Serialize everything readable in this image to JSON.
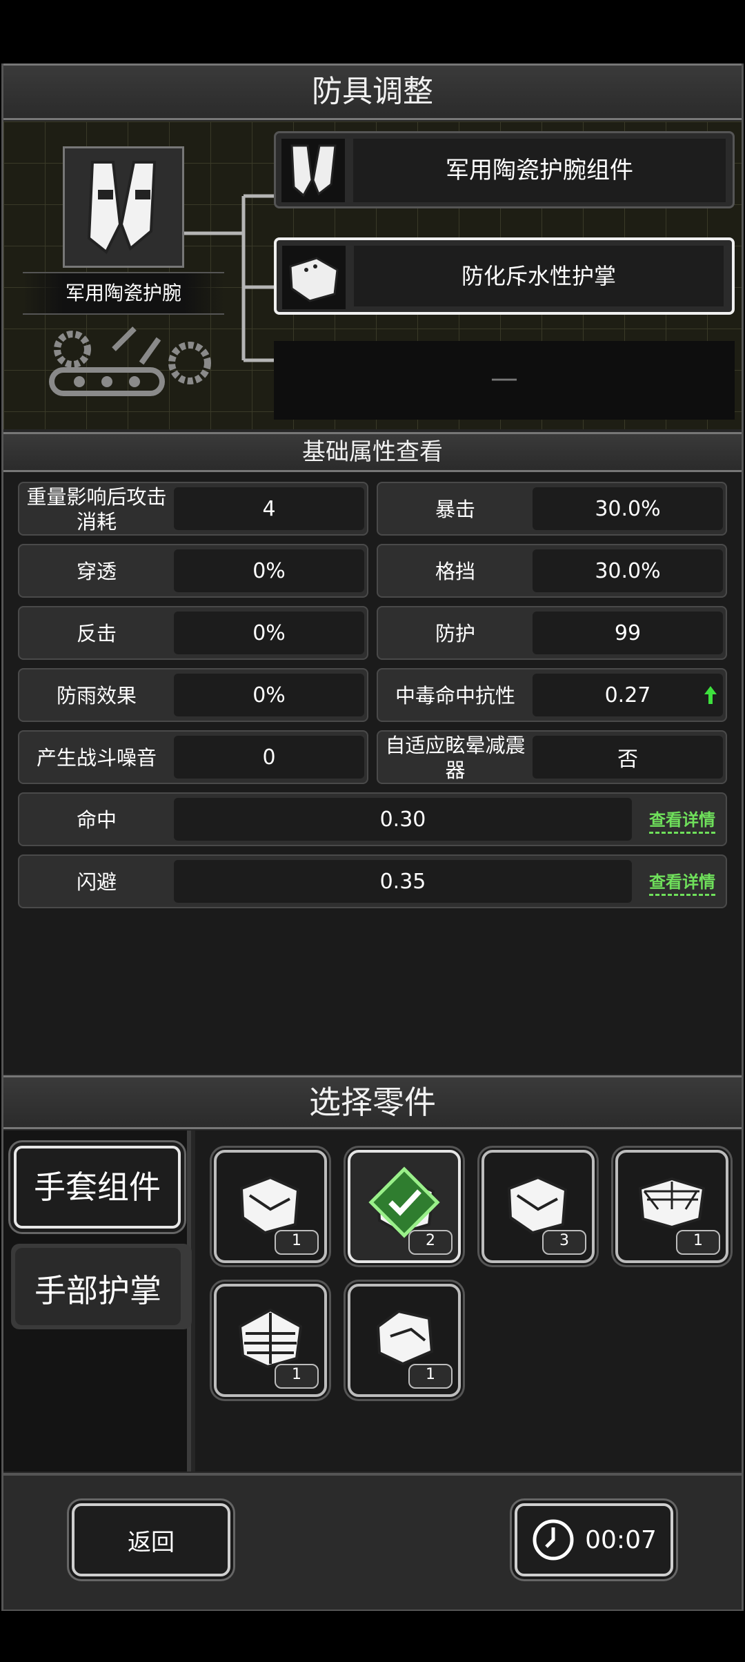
{
  "header": {
    "title": "防具调整"
  },
  "armor": {
    "main_name": "军用陶瓷护腕",
    "components": [
      {
        "label": "军用陶瓷护腕组件"
      },
      {
        "label": "防化斥水性护掌"
      },
      {
        "label": "—"
      }
    ]
  },
  "stats": {
    "title": "基础属性查看",
    "pairs": [
      {
        "left_label": "重量影响后攻击消耗",
        "left_value": "4",
        "right_label": "暴击",
        "right_value": "30.0%"
      },
      {
        "left_label": "穿透",
        "left_value": "0%",
        "right_label": "格挡",
        "right_value": "30.0%"
      },
      {
        "left_label": "反击",
        "left_value": "0%",
        "right_label": "防护",
        "right_value": "99"
      },
      {
        "left_label": "防雨效果",
        "left_value": "0%",
        "right_label": "中毒命中抗性",
        "right_value": "0.27"
      },
      {
        "left_label": "产生战斗噪音",
        "left_value": "0",
        "right_label": "自适应眩晕减震器",
        "right_value": "否"
      }
    ],
    "wide": [
      {
        "label": "命中",
        "value": "0.30",
        "detail": "查看详情"
      },
      {
        "label": "闪避",
        "value": "0.35",
        "detail": "查看详情"
      }
    ]
  },
  "parts": {
    "title": "选择零件",
    "categories": [
      {
        "label": "手套组件"
      },
      {
        "label": "手部护掌"
      }
    ],
    "items": [
      {
        "count": "1"
      },
      {
        "count": "2"
      },
      {
        "count": "3"
      },
      {
        "count": "1"
      },
      {
        "count": "1"
      },
      {
        "count": "1"
      }
    ]
  },
  "footer": {
    "back_label": "返回",
    "timer": "00:07"
  },
  "colors": {
    "accent_green": "#6fe05b",
    "border": "#777777"
  }
}
